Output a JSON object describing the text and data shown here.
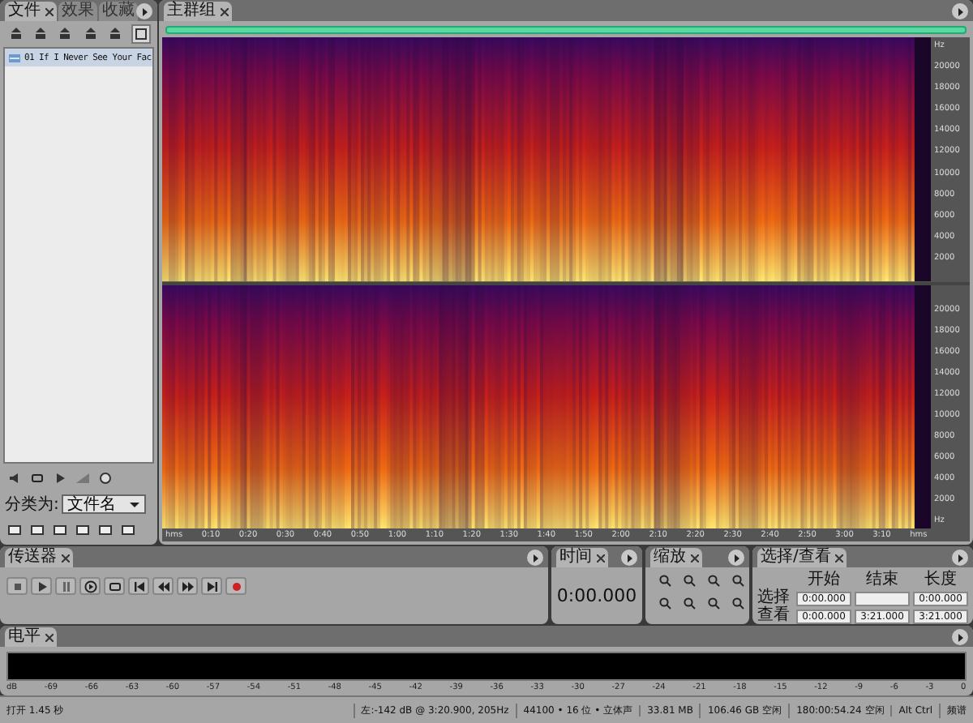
{
  "file_panel": {
    "tabs": [
      {
        "label": "文件",
        "selected": true
      },
      {
        "label": "效果",
        "selected": false
      },
      {
        "label": "收藏",
        "selected": false
      }
    ],
    "files": [
      {
        "name": "01 If I Never See Your Fac",
        "selected": true
      }
    ],
    "sort_label": "分类为:",
    "sort_value": "文件名"
  },
  "editor": {
    "tab": {
      "label": "主群组",
      "selected": true
    },
    "channels": [
      {
        "axis": [
          "Hz",
          "20000",
          "18000",
          "16000",
          "14000",
          "12000",
          "10000",
          "8000",
          "6000",
          "4000",
          "2000"
        ]
      },
      {
        "axis": [
          "20000",
          "18000",
          "16000",
          "14000",
          "12000",
          "10000",
          "8000",
          "6000",
          "4000",
          "2000",
          "Hz"
        ]
      }
    ],
    "time_axis": [
      "hms",
      "0:10",
      "0:20",
      "0:30",
      "0:40",
      "0:50",
      "1:00",
      "1:10",
      "1:20",
      "1:30",
      "1:40",
      "1:50",
      "2:00",
      "2:10",
      "2:20",
      "2:30",
      "2:40",
      "2:50",
      "3:00",
      "3:10",
      "hms"
    ]
  },
  "transport": {
    "tab": {
      "label": "传送器",
      "selected": true
    }
  },
  "time": {
    "tab": {
      "label": "时间",
      "selected": true
    },
    "value": "0:00.000"
  },
  "zoom": {
    "tab": {
      "label": "缩放",
      "selected": true
    }
  },
  "selection": {
    "tab": {
      "label": "选择/查看",
      "selected": true
    },
    "columns": [
      "开始",
      "结束",
      "长度"
    ],
    "rows": [
      {
        "label": "选择",
        "start": "0:00.000",
        "length": "0:00.000"
      },
      {
        "label": "查看",
        "start": "0:00.000",
        "end": "3:21.000",
        "length": "3:21.000"
      }
    ]
  },
  "levels": {
    "tab": {
      "label": "电平",
      "selected": true
    },
    "scale": [
      "dB",
      "-69",
      "-66",
      "-63",
      "-60",
      "-57",
      "-54",
      "-51",
      "-48",
      "-45",
      "-42",
      "-39",
      "-36",
      "-33",
      "-30",
      "-27",
      "-24",
      "-21",
      "-18",
      "-15",
      "-12",
      "-9",
      "-6",
      "-3",
      "0"
    ]
  },
  "status_bar": [
    "打开 1.45 秒",
    "左:-142 dB @ 3:20.900, 205Hz",
    "44100 • 16 位 • 立体声",
    "33.81 MB",
    "106.46 GB 空闲",
    "180:00:54.24 空闲",
    "Alt Ctrl",
    "频谱"
  ]
}
